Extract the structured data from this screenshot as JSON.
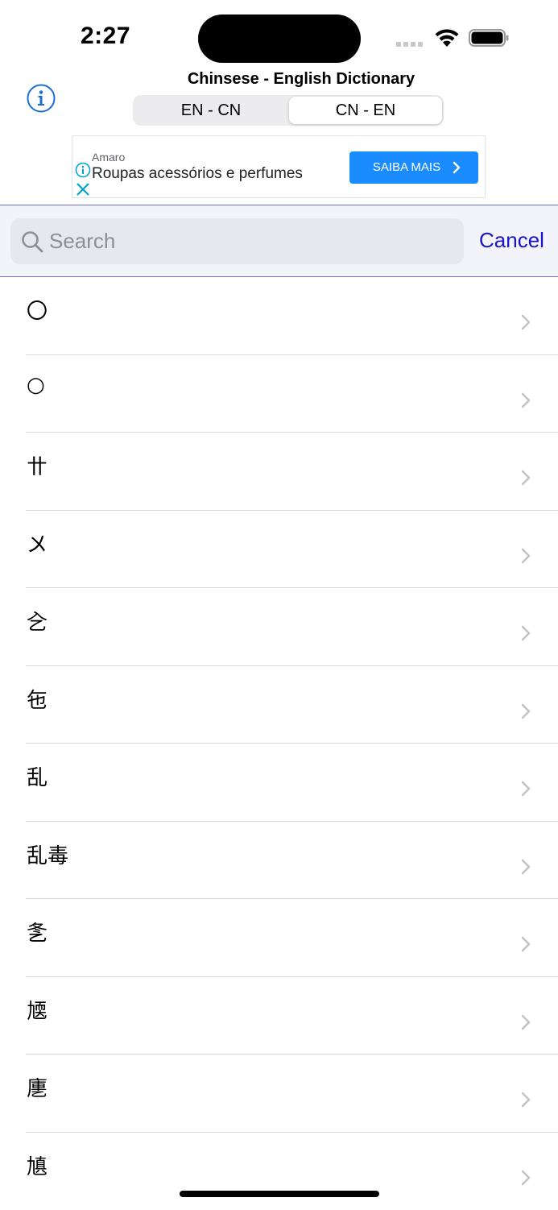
{
  "status_bar": {
    "time": "2:27"
  },
  "header": {
    "title": "Chinsese - English Dictionary",
    "segments": [
      "EN - CN",
      "CN - EN"
    ],
    "selected_segment": "CN - EN"
  },
  "ad": {
    "brand": "Amaro",
    "text": "Roupas acessórios e perfumes",
    "cta": "SAIBA MAIS"
  },
  "search": {
    "placeholder": "Search",
    "value": "",
    "cancel_label": "Cancel"
  },
  "list": {
    "items": [
      "〇",
      "○",
      "〹",
      "〤",
      "㐈",
      "㐌",
      "乱",
      "乱毒",
      "㐑",
      "㐡",
      "㐣",
      "㐤"
    ]
  },
  "colors": {
    "accent": "#1a13c9",
    "ad_button": "#1a8cff",
    "search_area": "#f2f4fa"
  }
}
